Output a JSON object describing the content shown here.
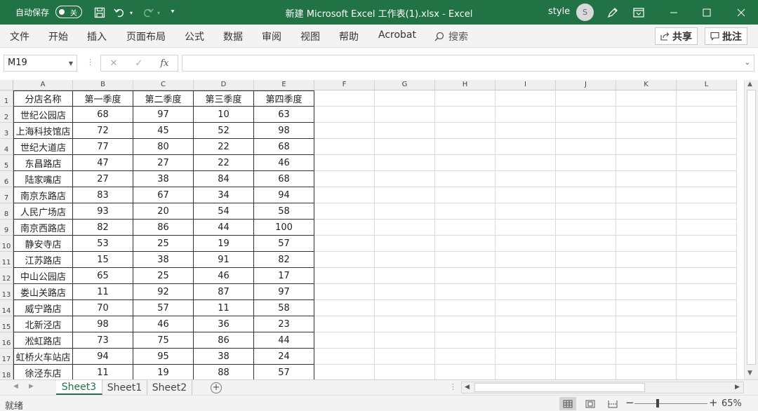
{
  "titlebar": {
    "autosave_label": "自动保存",
    "autosave_state": "关",
    "document_title": "新建 Microsoft Excel 工作表(1).xlsx  -  Excel",
    "user_name": "style",
    "user_initial": "S"
  },
  "ribbon": {
    "tabs": [
      "文件",
      "开始",
      "插入",
      "页面布局",
      "公式",
      "数据",
      "审阅",
      "视图",
      "帮助",
      "Acrobat"
    ],
    "search_label": "搜索",
    "share_label": "共享",
    "comments_label": "批注"
  },
  "formula_bar": {
    "name_box": "M19",
    "fx_label": "fx",
    "formula_value": ""
  },
  "sheet": {
    "columns": [
      "A",
      "B",
      "C",
      "D",
      "E",
      "F",
      "G",
      "H",
      "I",
      "J",
      "K",
      "L"
    ],
    "row_numbers": [
      "1",
      "2",
      "3",
      "4",
      "5",
      "6",
      "7",
      "8",
      "9",
      "10",
      "11",
      "12",
      "13",
      "14",
      "15",
      "16",
      "17",
      "18"
    ],
    "header": [
      "分店名称",
      "第一季度",
      "第二季度",
      "第三季度",
      "第四季度"
    ],
    "rows": [
      [
        "世纪公园店",
        "68",
        "97",
        "10",
        "63"
      ],
      [
        "上海科技馆店",
        "72",
        "45",
        "52",
        "98"
      ],
      [
        "世纪大道店",
        "77",
        "80",
        "22",
        "68"
      ],
      [
        "东昌路店",
        "47",
        "27",
        "22",
        "46"
      ],
      [
        "陆家嘴店",
        "27",
        "38",
        "84",
        "68"
      ],
      [
        "南京东路店",
        "83",
        "67",
        "34",
        "94"
      ],
      [
        "人民广场店",
        "93",
        "20",
        "54",
        "58"
      ],
      [
        "南京西路店",
        "82",
        "86",
        "44",
        "100"
      ],
      [
        "静安寺店",
        "53",
        "25",
        "19",
        "57"
      ],
      [
        "江苏路店",
        "15",
        "38",
        "91",
        "82"
      ],
      [
        "中山公园店",
        "65",
        "25",
        "46",
        "17"
      ],
      [
        "娄山关路店",
        "11",
        "92",
        "87",
        "97"
      ],
      [
        "威宁路店",
        "70",
        "57",
        "11",
        "58"
      ],
      [
        "北新泾店",
        "98",
        "46",
        "36",
        "23"
      ],
      [
        "淞虹路店",
        "73",
        "75",
        "86",
        "44"
      ],
      [
        "虹桥火车站店",
        "94",
        "95",
        "38",
        "24"
      ],
      [
        "徐泾东店",
        "11",
        "19",
        "88",
        "57"
      ]
    ]
  },
  "sheet_tabs": {
    "tabs": [
      "Sheet3",
      "Sheet1",
      "Sheet2"
    ],
    "active": "Sheet3"
  },
  "statusbar": {
    "status": "就绪",
    "zoom": "65%"
  },
  "colors": {
    "excel_green": "#217346",
    "ribbon_bg": "#f3f3f3"
  }
}
